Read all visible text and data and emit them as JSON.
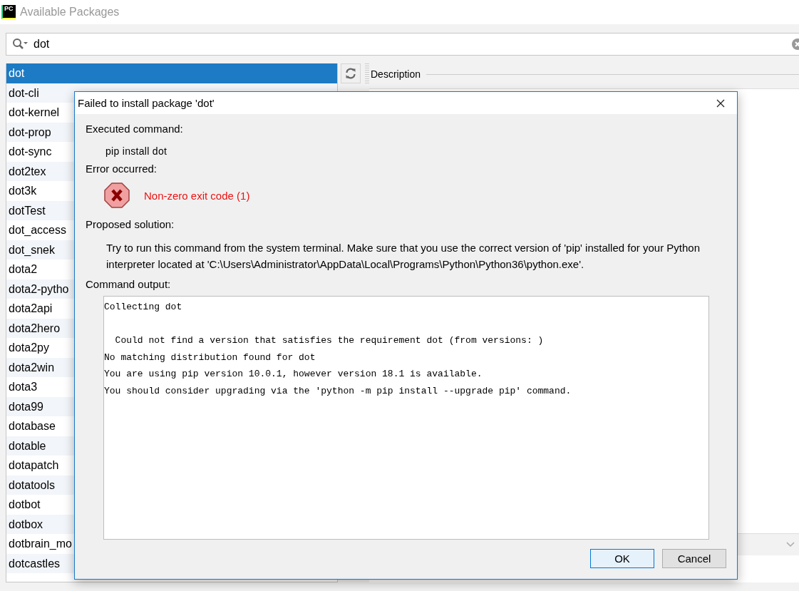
{
  "window": {
    "app_icon": "PC",
    "title": "Available Packages"
  },
  "search": {
    "value": "dot"
  },
  "packages": [
    {
      "name": "dot",
      "selected": true
    },
    {
      "name": "dot-cli",
      "selected": false
    },
    {
      "name": "dot-kernel",
      "selected": false
    },
    {
      "name": "dot-prop",
      "selected": false
    },
    {
      "name": "dot-sync",
      "selected": false
    },
    {
      "name": "dot2tex",
      "selected": false
    },
    {
      "name": "dot3k",
      "selected": false
    },
    {
      "name": "dotTest",
      "selected": false
    },
    {
      "name": "dot_access",
      "selected": false
    },
    {
      "name": "dot_snek",
      "selected": false
    },
    {
      "name": "dota2",
      "selected": false
    },
    {
      "name": "dota2-pytho",
      "selected": false
    },
    {
      "name": "dota2api",
      "selected": false
    },
    {
      "name": "dota2hero",
      "selected": false
    },
    {
      "name": "dota2py",
      "selected": false
    },
    {
      "name": "dota2win",
      "selected": false
    },
    {
      "name": "dota3",
      "selected": false
    },
    {
      "name": "dota99",
      "selected": false
    },
    {
      "name": "dotabase",
      "selected": false
    },
    {
      "name": "dotable",
      "selected": false
    },
    {
      "name": "dotapatch",
      "selected": false
    },
    {
      "name": "dotatools",
      "selected": false
    },
    {
      "name": "dotbot",
      "selected": false
    },
    {
      "name": "dotbox",
      "selected": false
    },
    {
      "name": "dotbrain_mo",
      "selected": false
    },
    {
      "name": "dotcastles",
      "selected": false
    }
  ],
  "description": {
    "title": "Description"
  },
  "dialog": {
    "title": "Failed to install package 'dot'",
    "executed_label": "Executed command:",
    "command": "pip install dot",
    "error_label": "Error occurred:",
    "error": "Non-zero exit code (1)",
    "solution_label": "Proposed solution:",
    "solution": "Try to run this command from the system terminal. Make sure that you use the correct version of 'pip' installed for your Python interpreter located at 'C:\\Users\\Administrator\\AppData\\Local\\Programs\\Python\\Python36\\python.exe'.",
    "output_label": "Command output:",
    "output": "Collecting dot\n\n  Could not find a version that satisfies the requirement dot (from versions: )\nNo matching distribution found for dot\nYou are using pip version 10.0.1, however version 18.1 is available.\nYou should consider upgrading via the 'python -m pip install --upgrade pip' command.",
    "buttons": [
      {
        "label": "OK",
        "kind": "default"
      },
      {
        "label": "Cancel",
        "kind": "normal"
      }
    ]
  }
}
